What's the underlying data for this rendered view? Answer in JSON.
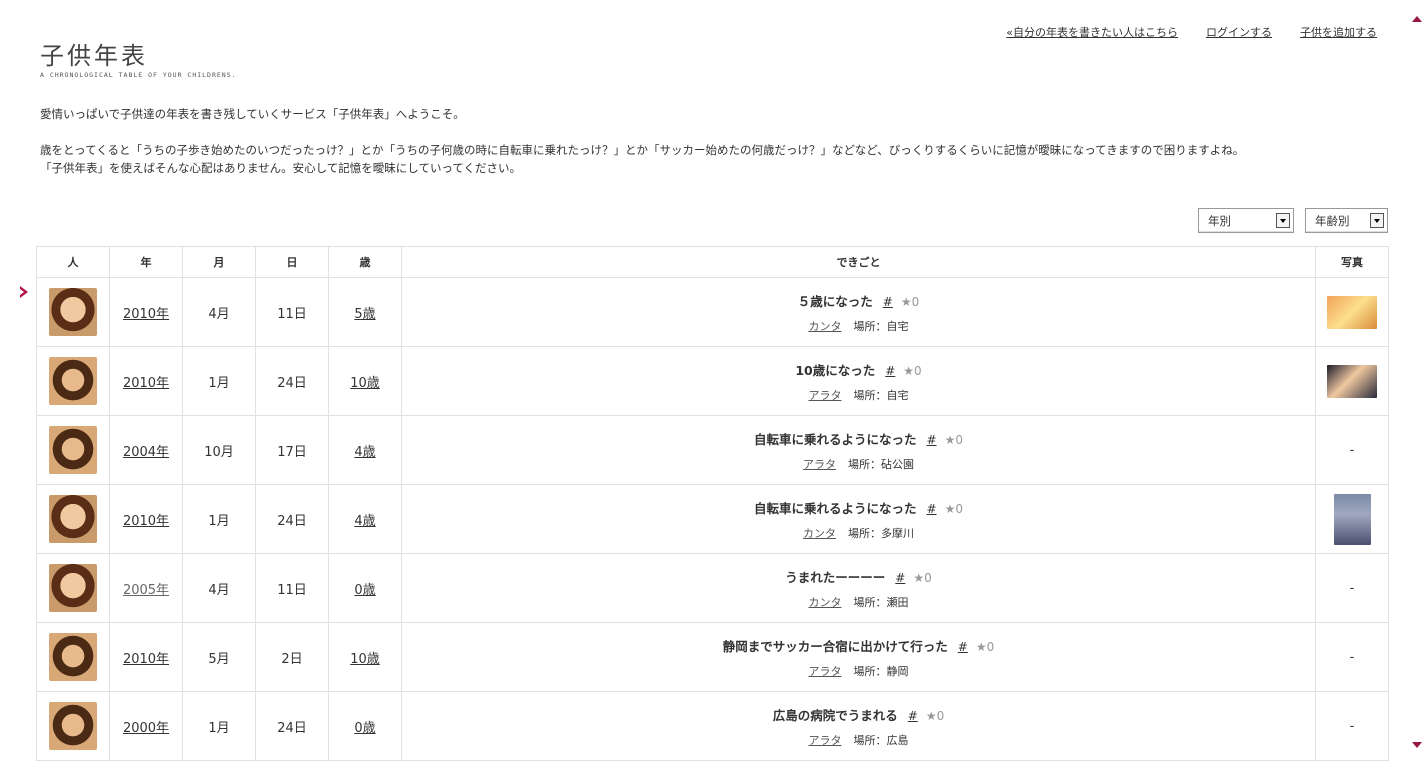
{
  "nav": {
    "write_link": "«自分の年表を書きたい人はこちら",
    "login": "ログインする",
    "add_child": "子供を追加する"
  },
  "logo": {
    "title": "子供年表",
    "subtitle": "A CHRONOLOGICAL TABLE OF YOUR CHILDRENS."
  },
  "intro": {
    "line1": "愛情いっぱいで子供達の年表を書き残していくサービス「子供年表」へようこそ。",
    "line2": "歳をとってくると「うちの子歩き始めたのいつだったっけ？」とか「うちの子何歳の時に自転車に乗れたっけ？」とか「サッカー始めたの何歳だっけ？」などなど、びっくりするくらいに記憶が曖昧になってきますので困りますよね。",
    "line3": "「子供年表」を使えばそんな心配はありません。安心して記憶を曖昧にしていってください。"
  },
  "filters": {
    "year": "年別",
    "age": "年齢別"
  },
  "table": {
    "headers": {
      "person": "人",
      "year": "年",
      "month": "月",
      "day": "日",
      "age": "歳",
      "event": "できごと",
      "photo": "写真"
    },
    "rows": [
      {
        "child": "カンタ",
        "year": "2010年",
        "month": "4月",
        "day": "11日",
        "age": "5歳",
        "title": "５歳になった",
        "hash": "#",
        "stars": "★0",
        "place": "場所：自宅",
        "photo": ""
      },
      {
        "child": "アラタ",
        "year": "2010年",
        "month": "1月",
        "day": "24日",
        "age": "10歳",
        "title": "10歳になった",
        "hash": "#",
        "stars": "★0",
        "place": "場所：自宅",
        "photo": ""
      },
      {
        "child": "アラタ",
        "year": "2004年",
        "month": "10月",
        "day": "17日",
        "age": "4歳",
        "title": "自転車に乗れるようになった",
        "hash": "#",
        "stars": "★0",
        "place": "場所：砧公園",
        "photo": "-"
      },
      {
        "child": "カンタ",
        "year": "2010年",
        "month": "1月",
        "day": "24日",
        "age": "4歳",
        "title": "自転車に乗れるようになった",
        "hash": "#",
        "stars": "★0",
        "place": "場所：多摩川",
        "photo": ""
      },
      {
        "child": "カンタ",
        "year": "2005年",
        "month": "4月",
        "day": "11日",
        "age": "0歳",
        "title": "うまれたーーーー",
        "hash": "#",
        "stars": "★0",
        "place": "場所：瀬田",
        "photo": "-"
      },
      {
        "child": "アラタ",
        "year": "2010年",
        "month": "5月",
        "day": "2日",
        "age": "10歳",
        "title": "静岡までサッカー合宿に出かけて行った",
        "hash": "#",
        "stars": "★0",
        "place": "場所：静岡",
        "photo": "-"
      },
      {
        "child": "アラタ",
        "year": "2000年",
        "month": "1月",
        "day": "24日",
        "age": "0歳",
        "title": "広島の病院でうまれる",
        "hash": "#",
        "stars": "★0",
        "place": "場所：広島",
        "photo": "-"
      }
    ]
  }
}
